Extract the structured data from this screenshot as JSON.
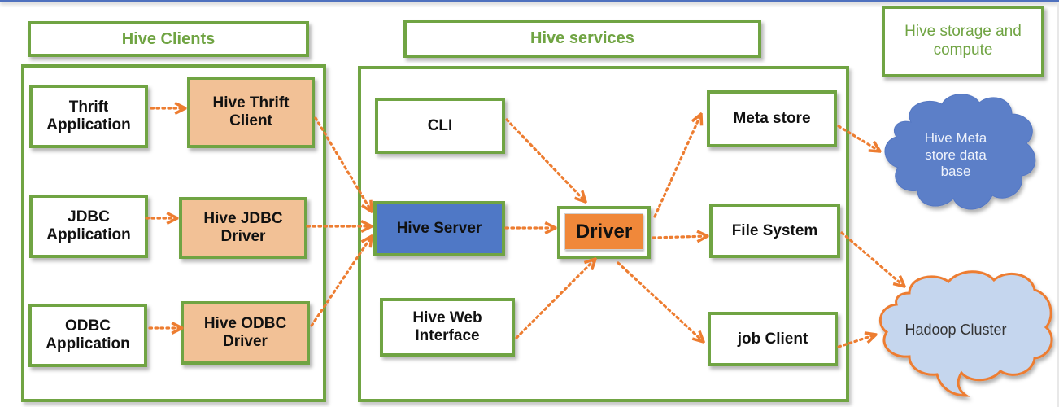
{
  "groups": {
    "clients": {
      "title": "Hive Clients"
    },
    "services": {
      "title": "Hive services"
    },
    "storage": {
      "title": "Hive storage and compute"
    }
  },
  "nodes": {
    "thrift_app": "Thrift Application",
    "thrift_client": "Hive Thrift Client",
    "jdbc_app": "JDBC Application",
    "jdbc_driver": "Hive JDBC Driver",
    "odbc_app": "ODBC Application",
    "odbc_driver": "Hive ODBC Driver",
    "cli": "CLI",
    "hive_server": "Hive Server",
    "web_interface": "Hive Web Interface",
    "driver": "Driver",
    "meta_store": "Meta store",
    "file_system": "File System",
    "job_client": "job Client",
    "meta_db": "Hive Meta store data base",
    "hadoop": "Hadoop Cluster"
  },
  "colors": {
    "border_green": "#70a443",
    "arrow_orange": "#ed7d31",
    "client_tan": "#f2c196",
    "server_blue": "#4f78c6",
    "driver_orange": "#f0883a",
    "meta_cloud_blue": "#5b7fc8",
    "hadoop_cloud_fill": "#c5d6ee"
  },
  "edges": [
    {
      "from": "Thrift Application",
      "to": "Hive Thrift Client"
    },
    {
      "from": "JDBC Application",
      "to": "Hive JDBC Driver"
    },
    {
      "from": "ODBC Application",
      "to": "Hive ODBC Driver"
    },
    {
      "from": "Hive Thrift Client",
      "to": "Hive Server"
    },
    {
      "from": "Hive JDBC Driver",
      "to": "Hive Server"
    },
    {
      "from": "Hive ODBC Driver",
      "to": "Hive Server"
    },
    {
      "from": "CLI",
      "to": "Driver"
    },
    {
      "from": "Hive Server",
      "to": "Driver"
    },
    {
      "from": "Hive Web Interface",
      "to": "Driver"
    },
    {
      "from": "Driver",
      "to": "Meta store"
    },
    {
      "from": "Driver",
      "to": "File System"
    },
    {
      "from": "Driver",
      "to": "job Client"
    },
    {
      "from": "Meta store",
      "to": "Hive Meta store data base"
    },
    {
      "from": "File System",
      "to": "Hadoop Cluster"
    },
    {
      "from": "job Client",
      "to": "Hadoop Cluster"
    }
  ]
}
